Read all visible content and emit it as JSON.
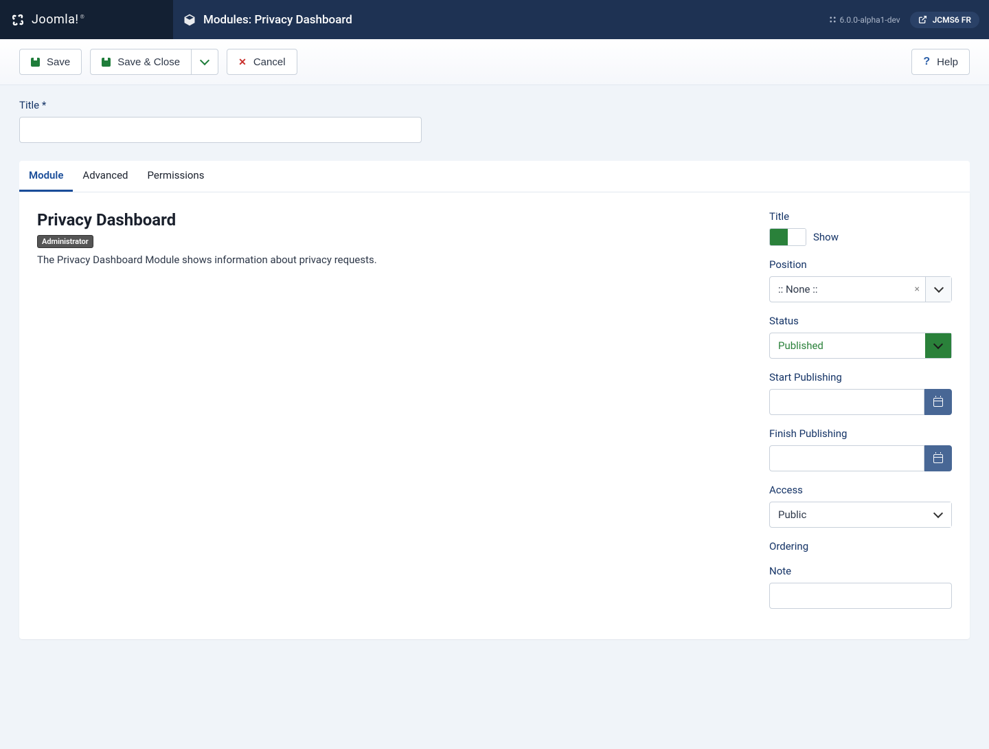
{
  "brand": "Joomla!",
  "header": {
    "page_title": "Modules: Privacy Dashboard",
    "version": "6.0.0-alpha1-dev",
    "user_tag": "JCMS6 FR"
  },
  "toolbar": {
    "save": "Save",
    "save_close": "Save & Close",
    "cancel": "Cancel",
    "help": "Help"
  },
  "form": {
    "title_label": "Title",
    "title_value": ""
  },
  "tabs": {
    "module": "Module",
    "advanced": "Advanced",
    "permissions": "Permissions"
  },
  "module": {
    "heading": "Privacy Dashboard",
    "badge": "Administrator",
    "description": "The Privacy Dashboard Module shows information about privacy requests."
  },
  "sidebar": {
    "title_label": "Title",
    "title_toggle_text": "Show",
    "position_label": "Position",
    "position_value": ":: None ::",
    "status_label": "Status",
    "status_value": "Published",
    "start_label": "Start Publishing",
    "start_value": "",
    "finish_label": "Finish Publishing",
    "finish_value": "",
    "access_label": "Access",
    "access_value": "Public",
    "ordering_label": "Ordering",
    "note_label": "Note",
    "note_value": ""
  }
}
